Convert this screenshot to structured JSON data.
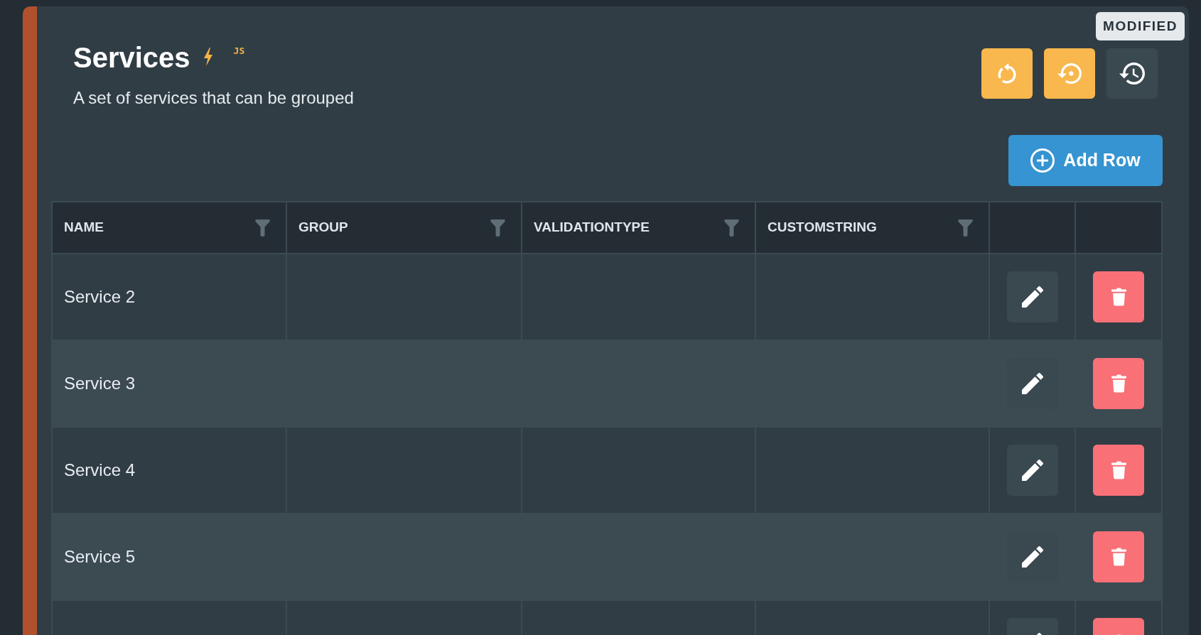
{
  "panel": {
    "badge": "MODIFIED",
    "title": "Services",
    "title_tag": "JS",
    "description": "A set of services that can be grouped"
  },
  "toolbar": [
    {
      "kind": "refresh",
      "highlighted": true
    },
    {
      "kind": "reset",
      "highlighted": true
    },
    {
      "kind": "history",
      "highlighted": false
    }
  ],
  "add_button": {
    "label": "Add Row"
  },
  "table": {
    "columns": [
      {
        "label": "NAME"
      },
      {
        "label": "GROUP"
      },
      {
        "label": "VALIDATIONTYPE"
      },
      {
        "label": "CUSTOMSTRING"
      }
    ],
    "rows": [
      {
        "name": "Service 2"
      },
      {
        "name": "Service 3"
      },
      {
        "name": "Service 4"
      },
      {
        "name": "Service 5"
      },
      {}
    ]
  }
}
